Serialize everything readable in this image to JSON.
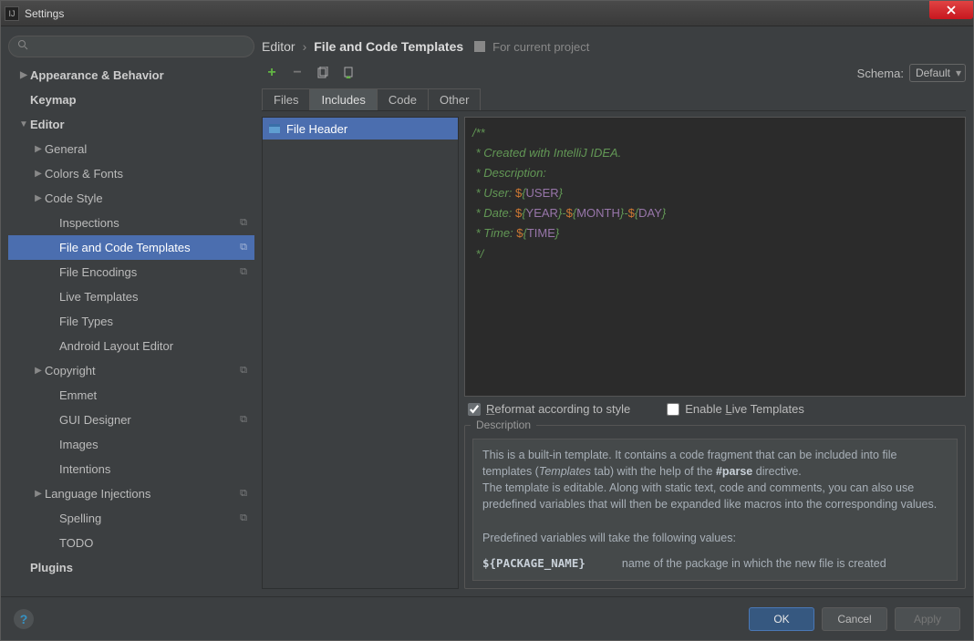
{
  "window": {
    "title": "Settings"
  },
  "search": {
    "placeholder": ""
  },
  "tree": [
    {
      "label": "Appearance & Behavior",
      "indent": 0,
      "bold": true,
      "arrow": "right",
      "badge": false
    },
    {
      "label": "Keymap",
      "indent": 0,
      "bold": true,
      "arrow": "",
      "badge": false
    },
    {
      "label": "Editor",
      "indent": 0,
      "bold": true,
      "arrow": "down",
      "badge": false
    },
    {
      "label": "General",
      "indent": 1,
      "bold": false,
      "arrow": "right",
      "badge": false
    },
    {
      "label": "Colors & Fonts",
      "indent": 1,
      "bold": false,
      "arrow": "right",
      "badge": false
    },
    {
      "label": "Code Style",
      "indent": 1,
      "bold": false,
      "arrow": "right",
      "badge": false
    },
    {
      "label": "Inspections",
      "indent": 2,
      "bold": false,
      "arrow": "",
      "badge": true
    },
    {
      "label": "File and Code Templates",
      "indent": 2,
      "bold": false,
      "arrow": "",
      "badge": true,
      "selected": true
    },
    {
      "label": "File Encodings",
      "indent": 2,
      "bold": false,
      "arrow": "",
      "badge": true
    },
    {
      "label": "Live Templates",
      "indent": 2,
      "bold": false,
      "arrow": "",
      "badge": false
    },
    {
      "label": "File Types",
      "indent": 2,
      "bold": false,
      "arrow": "",
      "badge": false
    },
    {
      "label": "Android Layout Editor",
      "indent": 2,
      "bold": false,
      "arrow": "",
      "badge": false
    },
    {
      "label": "Copyright",
      "indent": 1,
      "bold": false,
      "arrow": "right",
      "badge": true
    },
    {
      "label": "Emmet",
      "indent": 2,
      "bold": false,
      "arrow": "",
      "badge": false
    },
    {
      "label": "GUI Designer",
      "indent": 2,
      "bold": false,
      "arrow": "",
      "badge": true
    },
    {
      "label": "Images",
      "indent": 2,
      "bold": false,
      "arrow": "",
      "badge": false
    },
    {
      "label": "Intentions",
      "indent": 2,
      "bold": false,
      "arrow": "",
      "badge": false
    },
    {
      "label": "Language Injections",
      "indent": 1,
      "bold": false,
      "arrow": "right",
      "badge": true
    },
    {
      "label": "Spelling",
      "indent": 2,
      "bold": false,
      "arrow": "",
      "badge": true
    },
    {
      "label": "TODO",
      "indent": 2,
      "bold": false,
      "arrow": "",
      "badge": false
    },
    {
      "label": "Plugins",
      "indent": 0,
      "bold": true,
      "arrow": "",
      "badge": false
    }
  ],
  "breadcrumb": {
    "part1": "Editor",
    "part2": "File and Code Templates",
    "scope": "For current project"
  },
  "schema": {
    "label": "Schema:",
    "value": "Default"
  },
  "tabs": [
    "Files",
    "Includes",
    "Code",
    "Other"
  ],
  "active_tab": 1,
  "templates": [
    {
      "name": "File Header"
    }
  ],
  "code_lines": [
    {
      "t": "/**",
      "cls": "c-green"
    },
    {
      "t": " * Created with IntelliJ IDEA.",
      "cls": "c-green"
    },
    {
      "t": " * Description:",
      "cls": "c-green"
    },
    {
      "prefix": " * User: ",
      "vars": [
        "${USER}"
      ]
    },
    {
      "prefix": " * Date: ",
      "vars": [
        "${YEAR}",
        "-",
        "${MONTH}",
        "-",
        "${DAY}"
      ]
    },
    {
      "prefix": " * Time: ",
      "vars": [
        "${TIME}"
      ]
    },
    {
      "t": " */",
      "cls": "c-green"
    }
  ],
  "checks": {
    "reformat": "Reformat according to style",
    "reformat_checked": true,
    "live": "Enable Live Templates",
    "live_checked": false
  },
  "description": {
    "legend": "Description",
    "p1a": "This is a built-in template. It contains a code fragment that can be included into file templates (",
    "p1i": "Templates",
    "p1b": " tab) with the help of the ",
    "p1bold": "#parse",
    "p1c": " directive.",
    "p2": "The template is editable. Along with static text, code and comments, you can also use predefined variables that will then be expanded like macros into the corresponding values.",
    "p3": "Predefined variables will take the following values:",
    "var_name": "${PACKAGE_NAME}",
    "var_desc": "name of the package in which the new file is created"
  },
  "footer": {
    "ok": "OK",
    "cancel": "Cancel",
    "apply": "Apply"
  }
}
